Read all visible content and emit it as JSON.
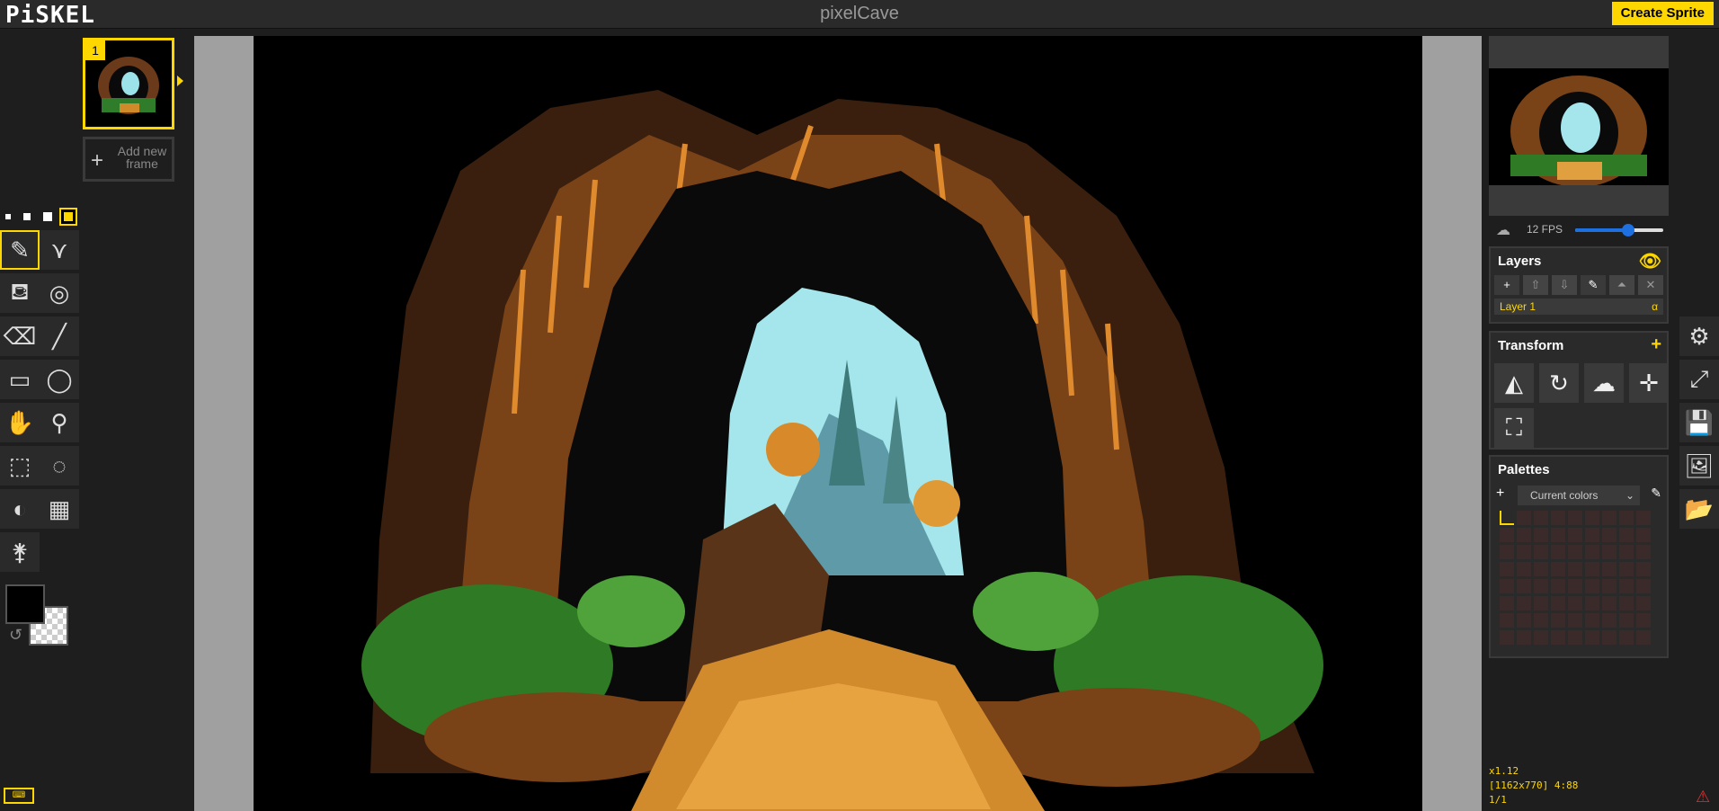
{
  "app": {
    "logo": "PiSKEL",
    "title": "pixelCave",
    "create_label": "Create Sprite"
  },
  "frames": {
    "items": [
      {
        "number": "1"
      }
    ],
    "add_label": "Add new frame"
  },
  "preview": {
    "fps_label": "12 FPS",
    "fps_value": 12,
    "fps_fraction": 0.6
  },
  "layers": {
    "title": "Layers",
    "items": [
      {
        "name": "Layer 1",
        "alpha": "α"
      }
    ]
  },
  "transform": {
    "title": "Transform"
  },
  "palettes": {
    "title": "Palettes",
    "selected": "Current colors"
  },
  "status": {
    "zoom": "x1.12",
    "size": "[1162x770] 4:88",
    "frame": "1/1"
  },
  "colors": {
    "accent": "#ffd700",
    "primary": "#000000",
    "secondary": "transparent",
    "fps_accent": "#1e6fe0"
  }
}
